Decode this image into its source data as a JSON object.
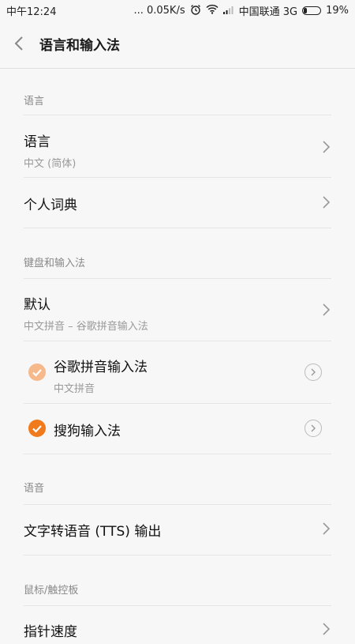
{
  "status_bar": {
    "time": "中午12:24",
    "network_speed": "... 0.05K/s",
    "carrier": "中国联通 3G",
    "battery": "19%"
  },
  "header": {
    "title": "语言和输入法"
  },
  "sections": {
    "language": "语言",
    "keyboard": "键盘和输入法",
    "speech": "语音",
    "pointer": "鼠标/触控板"
  },
  "rows": {
    "language": {
      "title": "语言",
      "subtitle": "中文 (简体)"
    },
    "dictionary": {
      "title": "个人词典"
    },
    "default": {
      "title": "默认",
      "subtitle": "中文拼音 – 谷歌拼音输入法"
    },
    "google_ime": {
      "title": "谷歌拼音输入法",
      "subtitle": "中文拼音",
      "checked": true
    },
    "sogou_ime": {
      "title": "搜狗输入法",
      "checked": true
    },
    "tts": {
      "title": "文字转语音 (TTS) 输出"
    },
    "pointer_speed": {
      "title": "指针速度"
    }
  },
  "colors": {
    "accent": "#f07a1c",
    "accent_light": "#f6b98c"
  }
}
